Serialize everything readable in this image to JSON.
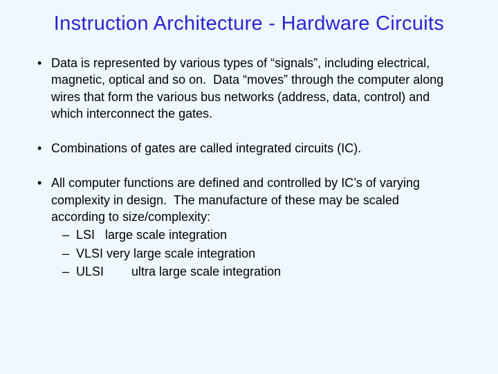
{
  "title": "Instruction Architecture - Hardware Circuits",
  "bullets": [
    {
      "text": "Data is represented by various types of “signals”, including electrical, magnetic, optical and so on.  Data “moves” through the computer along wires that form the various bus networks (address, data, control) and which interconnect the gates."
    },
    {
      "text": "Combinations of gates are called integrated circuits (IC)."
    },
    {
      "text": "All computer functions are defined and controlled by IC’s of varying complexity in design.  The manufacture of these may be scaled according to size/complexity:",
      "sub": [
        "LSI   large scale integration",
        "VLSI very large scale integration",
        "ULSI        ultra large scale integration"
      ]
    }
  ]
}
